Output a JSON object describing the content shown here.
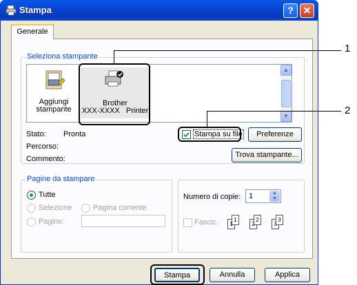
{
  "window": {
    "title": "Stampa",
    "help_glyph": "?",
    "close_glyph": "✕"
  },
  "tabs": [
    {
      "label": "Generale"
    }
  ],
  "select_printer": {
    "legend": "Seleziona stampante",
    "items": [
      {
        "label_line1": "Aggiungi",
        "label_line2": "stampante"
      },
      {
        "label_line1": "Brother",
        "label_line2": "XXX-XXXX   Printer"
      }
    ]
  },
  "status": {
    "stato_label": "Stato:",
    "stato_value": "Pronta",
    "percorso_label": "Percorso:",
    "commento_label": "Commento:"
  },
  "print_to_file": {
    "label": "Stampa su file",
    "checked": true
  },
  "buttons": {
    "preferences": "Preferenze",
    "find_printer": "Trova stampante...",
    "print": "Stampa",
    "cancel": "Annulla",
    "apply": "Applica"
  },
  "page_range": {
    "legend": "Pagine da stampare",
    "all": "Tutte",
    "selection": "Selezione",
    "current_page": "Pagina corrente",
    "pages": "Pagine:",
    "pages_value": ""
  },
  "copies": {
    "label": "Numero di copie:",
    "value": "1",
    "collate_label": "Fascic."
  },
  "collate_pages": [
    "1",
    "1",
    "2",
    "2",
    "3",
    "3"
  ],
  "callouts": {
    "one": "1",
    "two": "2"
  }
}
